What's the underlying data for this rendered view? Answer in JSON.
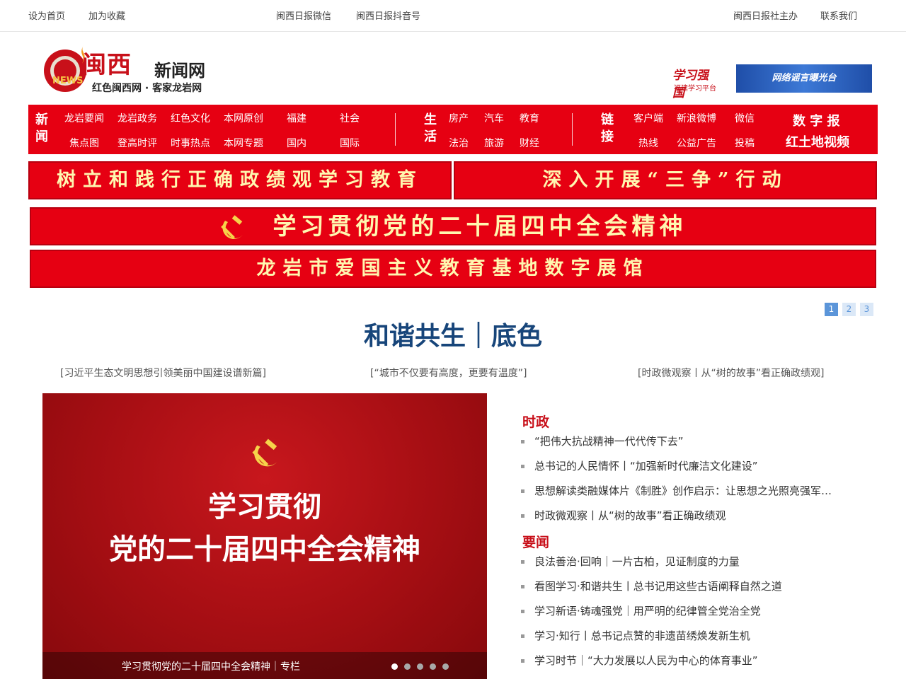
{
  "topbar": {
    "set_home": "设为首页",
    "add_fav": "加为收藏",
    "wechat": "闽西日报微信",
    "douyin": "闽西日报抖音号",
    "sponsor": "闽西日报社主办",
    "contact": "联系我们"
  },
  "header": {
    "logo_title": "闽西",
    "logo_suffix": "新闻网",
    "logo_slogan": "红色闽西网 · 客家龙岩网",
    "logo_badge": "NEWS",
    "xuexi_title": "学习强国",
    "xuexi_sub": "福建学习平台",
    "rumor_label": "网络谣言曝光台"
  },
  "nav": {
    "news_cat": [
      "新",
      "闻"
    ],
    "news_row1": [
      "龙岩要闻",
      "龙岩政务",
      "红色文化",
      "本网原创",
      "福建",
      "社会"
    ],
    "news_row2": [
      "焦点图",
      "登高时评",
      "时事热点",
      "本网专题",
      "国内",
      "国际"
    ],
    "life_cat": [
      "生",
      "活"
    ],
    "life_row1": [
      "房产",
      "汽车",
      "教育"
    ],
    "life_row2": [
      "法治",
      "旅游",
      "财经"
    ],
    "link_cat": [
      "链",
      "接"
    ],
    "link_row1": [
      "客户端",
      "新浪微博",
      "微信"
    ],
    "link_row2": [
      "热线",
      "公益广告",
      "投稿"
    ],
    "digital_paper": "数 字 报",
    "video": "红土地视频"
  },
  "banners": {
    "b1": "树立和践行正确政绩观学习教育",
    "b2": "深入开展“三争”行动",
    "b3": "学习贯彻党的二十届四中全会精神",
    "b4": "龙岩市爱国主义教育基地数字展馆"
  },
  "pager": [
    "1",
    "2",
    "3"
  ],
  "headline": "和谐共生｜底色",
  "sublinks": [
    "[习近平生态文明思想引领美丽中国建设谱新篇]",
    "[“城市不仅要有高度，更要有温度”]",
    "[时政微观察丨从“树的故事”看正确政绩观]"
  ],
  "feature": {
    "line1": "学习贯彻",
    "line2": "党的二十届四中全会精神",
    "caption": "学习贯彻党的二十届四中全会精神｜专栏",
    "slide_count": 5,
    "active_slide": 1
  },
  "sections": [
    {
      "title": "时政",
      "items": [
        "“把伟大抗战精神一代代传下去”",
        "总书记的人民情怀丨“加强新时代廉洁文化建设”",
        "思想解读类融媒体片《制胜》创作启示：让思想之光照亮强军…",
        "时政微观察丨从“树的故事”看正确政绩观"
      ]
    },
    {
      "title": "要闻",
      "items": [
        "良法善治·回响｜一片古柏，见证制度的力量",
        "看图学习·和谐共生丨总书记用这些古语阐释自然之道",
        "学习新语·铸魂强党｜用严明的纪律管全党治全党",
        "学习·知行丨总书记点赞的非遗苗绣焕发新生机",
        "学习时节｜“大力发展以人民为中心的体育事业”"
      ]
    }
  ],
  "colors": {
    "brand_red": "#e60012",
    "headline_blue": "#17457a",
    "section_red": "#c8101a"
  }
}
